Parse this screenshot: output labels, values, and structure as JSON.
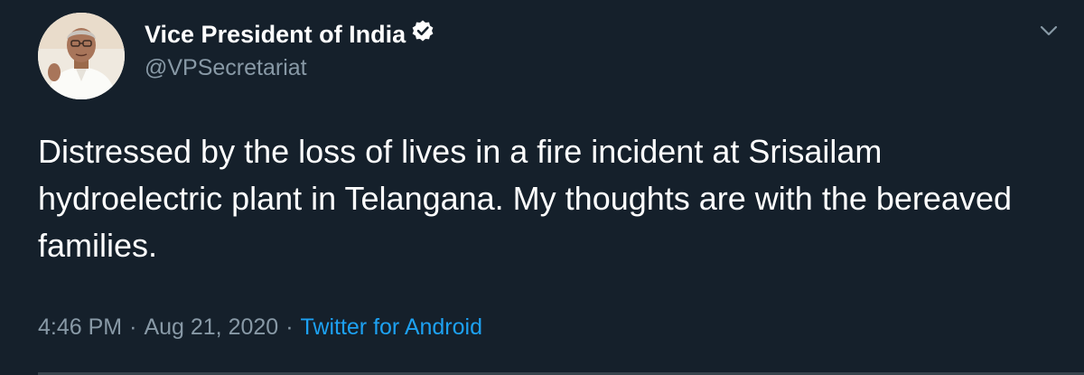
{
  "tweet": {
    "display_name": "Vice President of India",
    "verified_icon": "verified-badge-icon",
    "handle": "@VPSecretariat",
    "text": "Distressed by the loss of lives in a fire incident at Srisailam hydroelectric plant in Telangana. My thoughts are with the bereaved families.",
    "time": "4:46 PM",
    "separator": "·",
    "date": "Aug 21, 2020",
    "source": "Twitter for Android",
    "menu_icon": "chevron-down-icon"
  },
  "colors": {
    "background": "#15202b",
    "text_primary": "#ffffff",
    "text_secondary": "#8899a6",
    "link": "#1da1f2",
    "divider": "#38444d"
  }
}
